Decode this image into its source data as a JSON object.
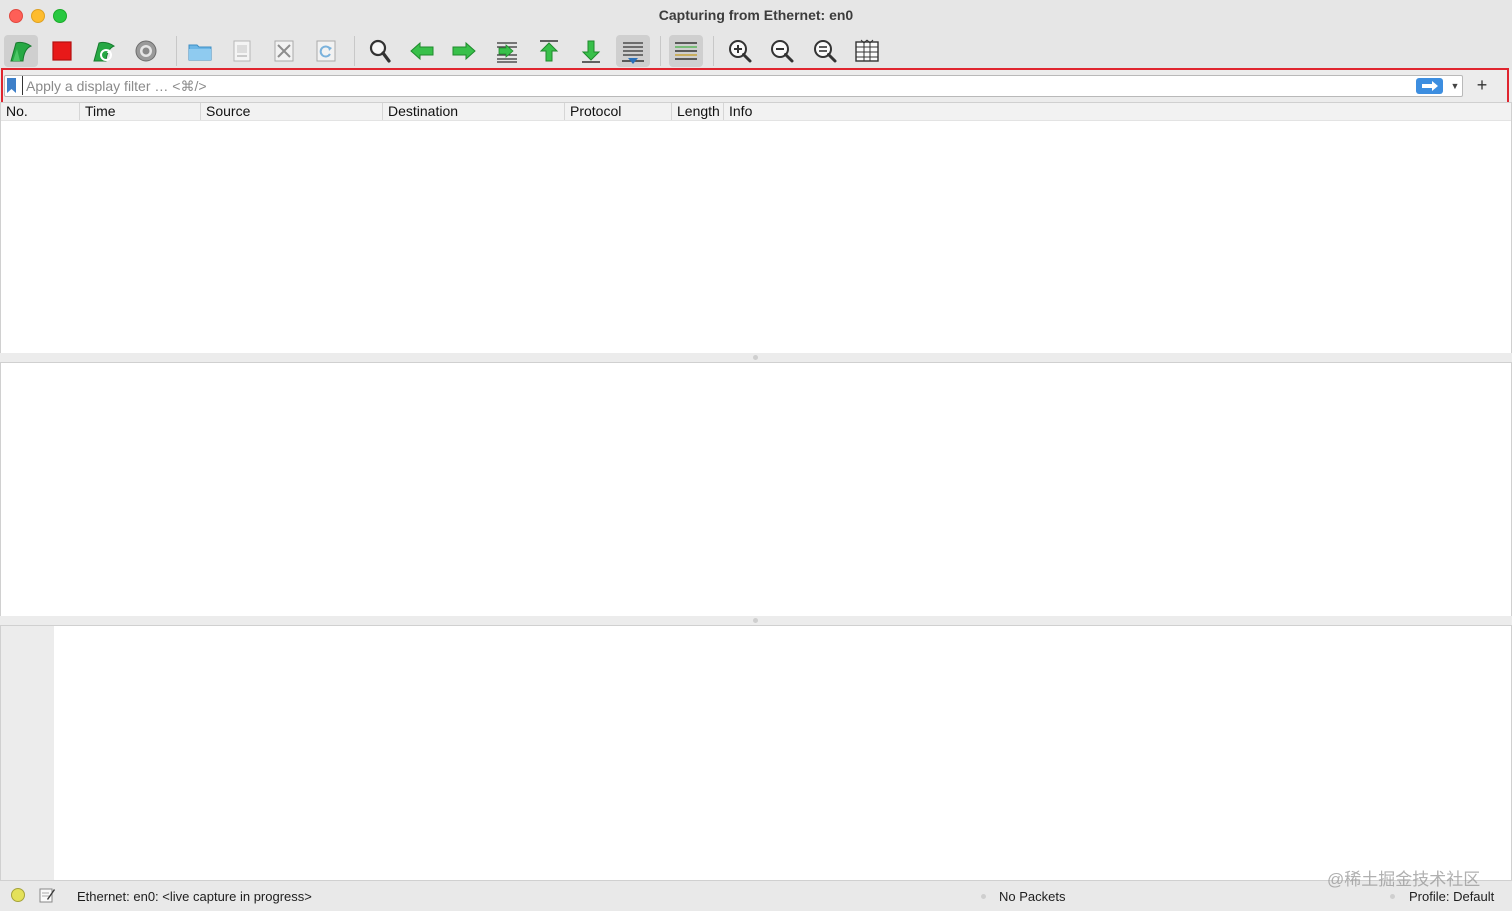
{
  "window": {
    "title": "Capturing from Ethernet: en0"
  },
  "toolbar": {
    "buttons": [
      {
        "icon": "shark-fin-start-icon"
      },
      {
        "icon": "stop-square-icon"
      },
      {
        "icon": "restart-capture-icon"
      },
      {
        "icon": "capture-options-gear-icon"
      },
      {
        "icon": "open-folder-icon"
      },
      {
        "icon": "save-file-icon"
      },
      {
        "icon": "close-file-icon"
      },
      {
        "icon": "reload-file-icon"
      },
      {
        "icon": "find-packet-icon"
      },
      {
        "icon": "go-back-arrow-icon"
      },
      {
        "icon": "go-forward-arrow-icon"
      },
      {
        "icon": "go-to-packet-icon"
      },
      {
        "icon": "first-packet-icon"
      },
      {
        "icon": "last-packet-icon"
      },
      {
        "icon": "auto-scroll-icon"
      },
      {
        "icon": "colorize-icon"
      },
      {
        "icon": "zoom-in-icon"
      },
      {
        "icon": "zoom-out-icon"
      },
      {
        "icon": "normal-size-icon"
      },
      {
        "icon": "resize-columns-icon"
      }
    ]
  },
  "filter": {
    "placeholder": "Apply a display filter … <⌘/>",
    "value": "",
    "add_label": "+"
  },
  "packet_list": {
    "columns": [
      "No.",
      "Time",
      "Source",
      "Destination",
      "Protocol",
      "Length",
      "Info"
    ]
  },
  "status_bar": {
    "capture_text": "Ethernet: en0: <live capture in progress>",
    "packets_text": "No Packets",
    "profile_text": "Profile: Default"
  },
  "watermark": {
    "text": "@稀土掘金技术社区"
  },
  "colors": {
    "highlight": "#e0252f",
    "apply_button": "#3d8ee0",
    "stop_red": "#e81919",
    "shark_green": "#27a844"
  }
}
